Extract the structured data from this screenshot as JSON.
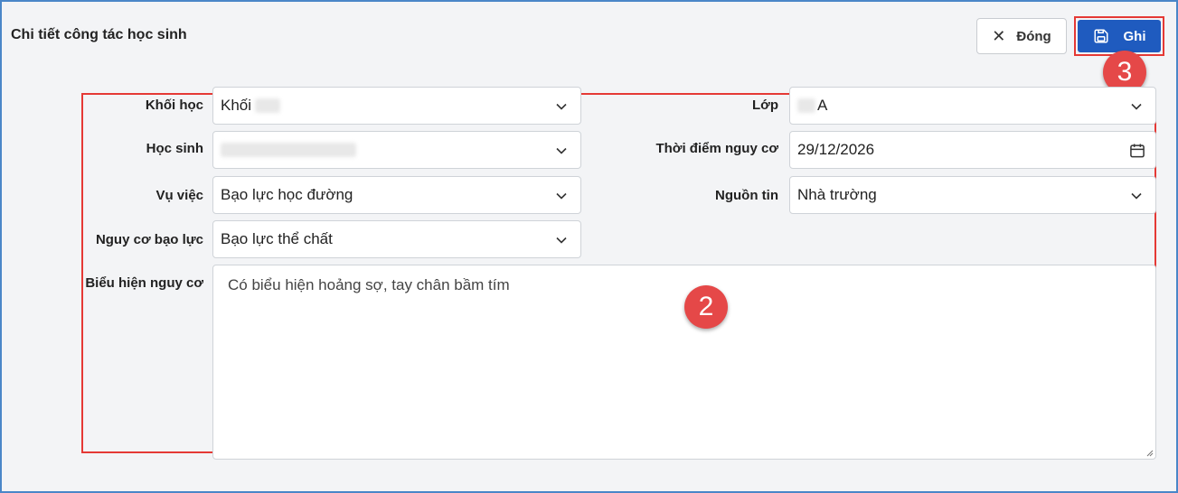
{
  "header": {
    "title": "Chi tiết công tác học sinh",
    "close_label": "Đóng",
    "save_label": "Ghi"
  },
  "annotations": {
    "badge_form": "2",
    "badge_save": "3"
  },
  "form": {
    "khoi_hoc": {
      "label": "Khối học",
      "value": "Khối"
    },
    "lop": {
      "label": "Lớp",
      "value": "A"
    },
    "hoc_sinh": {
      "label": "Học sinh",
      "value": ""
    },
    "thoi_diem": {
      "label": "Thời điểm nguy cơ",
      "value": "29/12/2026"
    },
    "vu_viec": {
      "label": "Vụ việc",
      "value": "Bạo lực học đường"
    },
    "nguon_tin": {
      "label": "Nguồn tin",
      "value": "Nhà trường"
    },
    "nguy_co": {
      "label": "Nguy cơ bạo lực",
      "value": "Bạo lực thể chất"
    },
    "bieu_hien": {
      "label": "Biểu hiện nguy cơ",
      "value": "Có biểu hiện hoảng sợ, tay chân bầm tím"
    }
  },
  "colors": {
    "primary": "#1f5bbf",
    "highlight": "#e53935",
    "badge": "#e54848"
  }
}
